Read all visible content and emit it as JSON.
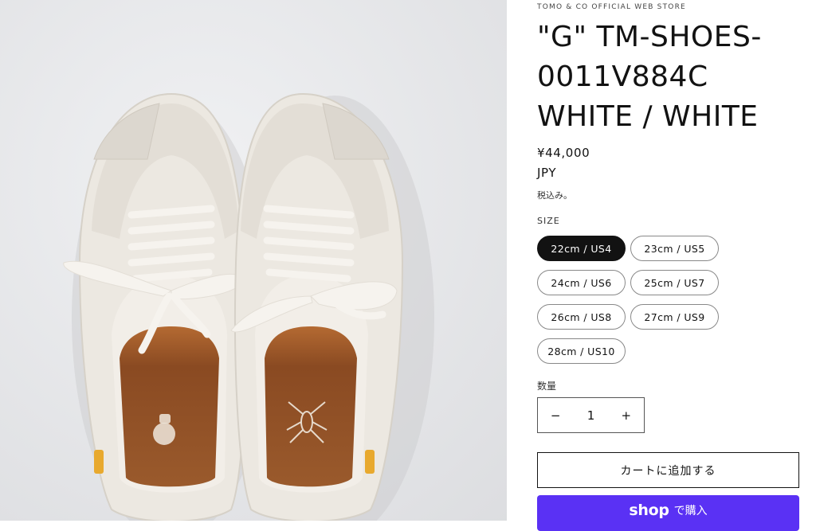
{
  "product": {
    "vendor": "TOMO & CO OFFICIAL WEB STORE",
    "title": "\"G\" TM-SHOES-0011V884C WHITE / WHITE",
    "price": "¥44,000",
    "currency": "JPY",
    "tax_note": "税込み。"
  },
  "size": {
    "label": "SIZE",
    "options": [
      "22cm / US4",
      "23cm / US5",
      "24cm / US6",
      "25cm / US7",
      "26cm / US8",
      "27cm / US9",
      "28cm / US10"
    ],
    "selected": "22cm / US4"
  },
  "quantity": {
    "label": "数量",
    "value": "1",
    "minus": "−",
    "plus": "+"
  },
  "buttons": {
    "add_to_cart": "カートに追加する",
    "shop_pay_logo": "shop",
    "shop_pay_label": "で購入"
  },
  "colors": {
    "accent_shop": "#5a31f4",
    "selected_pill": "#121212",
    "gallery_bg": "#e6e7e9"
  }
}
